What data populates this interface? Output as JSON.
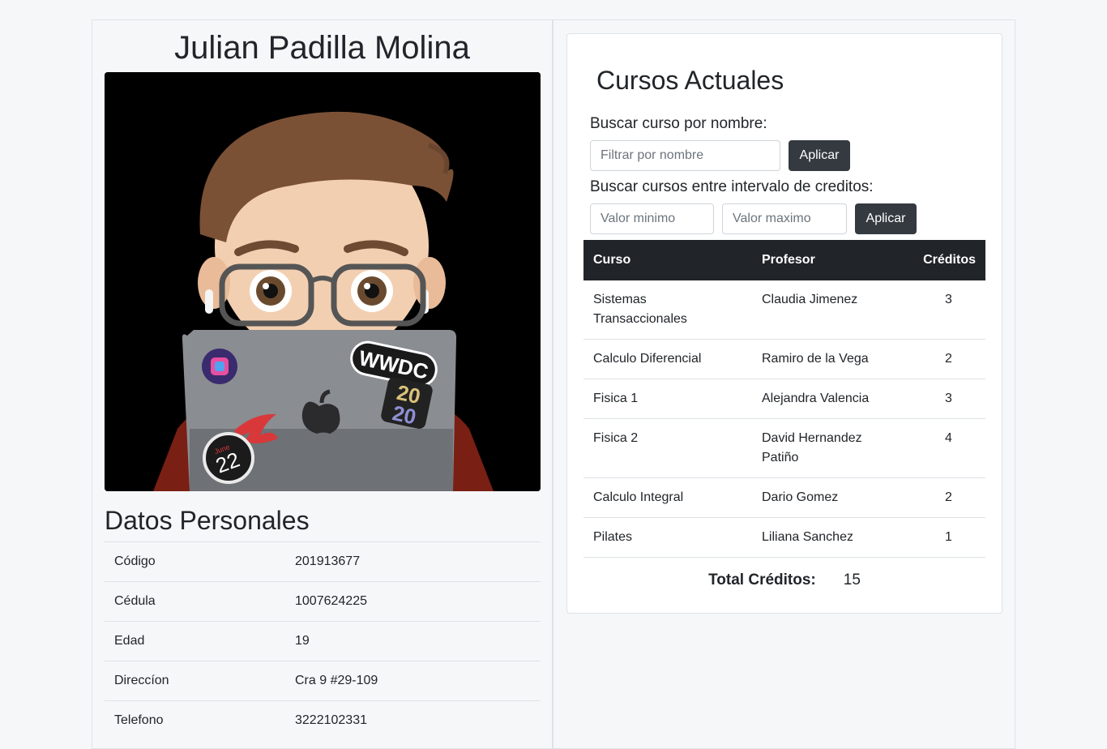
{
  "profile": {
    "name": "Julian Padilla Molina",
    "photo_alt": "Memoji con laptop",
    "stickers": {
      "wwdc": "WWDC",
      "wwdc_year_top": "20",
      "wwdc_year_bottom": "20",
      "badge_month": "June",
      "badge_day": "22"
    }
  },
  "personal": {
    "title": "Datos Personales",
    "rows": [
      {
        "label": "Código",
        "value": "201913677"
      },
      {
        "label": "Cédula",
        "value": "1007624225"
      },
      {
        "label": "Edad",
        "value": "19"
      },
      {
        "label": "Direccíon",
        "value": "Cra 9 #29-109"
      },
      {
        "label": "Telefono",
        "value": "3222102331"
      }
    ]
  },
  "courses": {
    "title": "Cursos Actuales",
    "name_filter": {
      "label": "Buscar curso por nombre:",
      "placeholder": "Filtrar por nombre",
      "button": "Aplicar"
    },
    "credit_filter": {
      "label": "Buscar cursos entre intervalo de creditos:",
      "min_placeholder": "Valor minimo",
      "max_placeholder": "Valor maximo",
      "button": "Aplicar"
    },
    "columns": [
      "Curso",
      "Profesor",
      "Créditos"
    ],
    "rows": [
      {
        "course": "Sistemas Transaccionales",
        "professor": "Claudia Jimenez",
        "credits": "3"
      },
      {
        "course": "Calculo Diferencial",
        "professor": "Ramiro de la Vega",
        "credits": "2"
      },
      {
        "course": "Fisica 1",
        "professor": "Alejandra Valencia",
        "credits": "3"
      },
      {
        "course": "Fisica 2",
        "professor": "David Hernandez Patiño",
        "credits": "4"
      },
      {
        "course": "Calculo Integral",
        "professor": "Dario Gomez",
        "credits": "2"
      },
      {
        "course": "Pilates",
        "professor": "Liliana Sanchez",
        "credits": "1"
      }
    ],
    "total_label": "Total Créditos:",
    "total_value": "15"
  },
  "colors": {
    "page_bg": "#f6f7f9",
    "button_bg": "#343a40",
    "table_header_bg": "#212529"
  }
}
